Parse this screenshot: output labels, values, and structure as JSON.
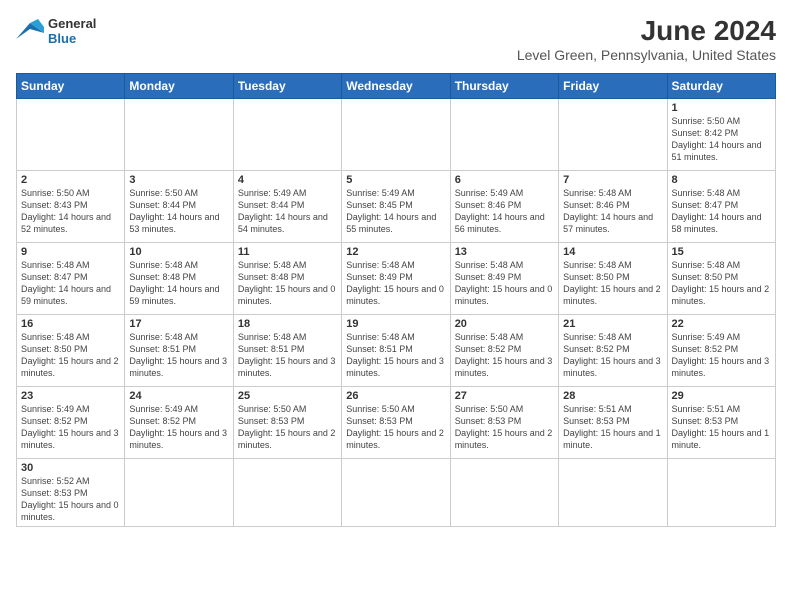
{
  "logo": {
    "text_general": "General",
    "text_blue": "Blue"
  },
  "header": {
    "title": "June 2024",
    "subtitle": "Level Green, Pennsylvania, United States"
  },
  "weekdays": [
    "Sunday",
    "Monday",
    "Tuesday",
    "Wednesday",
    "Thursday",
    "Friday",
    "Saturday"
  ],
  "weeks": [
    [
      {
        "day": "",
        "info": ""
      },
      {
        "day": "",
        "info": ""
      },
      {
        "day": "",
        "info": ""
      },
      {
        "day": "",
        "info": ""
      },
      {
        "day": "",
        "info": ""
      },
      {
        "day": "",
        "info": ""
      },
      {
        "day": "1",
        "info": "Sunrise: 5:50 AM\nSunset: 8:42 PM\nDaylight: 14 hours and 51 minutes."
      }
    ],
    [
      {
        "day": "2",
        "info": "Sunrise: 5:50 AM\nSunset: 8:43 PM\nDaylight: 14 hours and 52 minutes."
      },
      {
        "day": "3",
        "info": "Sunrise: 5:50 AM\nSunset: 8:44 PM\nDaylight: 14 hours and 53 minutes."
      },
      {
        "day": "4",
        "info": "Sunrise: 5:49 AM\nSunset: 8:44 PM\nDaylight: 14 hours and 54 minutes."
      },
      {
        "day": "5",
        "info": "Sunrise: 5:49 AM\nSunset: 8:45 PM\nDaylight: 14 hours and 55 minutes."
      },
      {
        "day": "6",
        "info": "Sunrise: 5:49 AM\nSunset: 8:46 PM\nDaylight: 14 hours and 56 minutes."
      },
      {
        "day": "7",
        "info": "Sunrise: 5:48 AM\nSunset: 8:46 PM\nDaylight: 14 hours and 57 minutes."
      },
      {
        "day": "8",
        "info": "Sunrise: 5:48 AM\nSunset: 8:47 PM\nDaylight: 14 hours and 58 minutes."
      }
    ],
    [
      {
        "day": "9",
        "info": "Sunrise: 5:48 AM\nSunset: 8:47 PM\nDaylight: 14 hours and 59 minutes."
      },
      {
        "day": "10",
        "info": "Sunrise: 5:48 AM\nSunset: 8:48 PM\nDaylight: 14 hours and 59 minutes."
      },
      {
        "day": "11",
        "info": "Sunrise: 5:48 AM\nSunset: 8:48 PM\nDaylight: 15 hours and 0 minutes."
      },
      {
        "day": "12",
        "info": "Sunrise: 5:48 AM\nSunset: 8:49 PM\nDaylight: 15 hours and 0 minutes."
      },
      {
        "day": "13",
        "info": "Sunrise: 5:48 AM\nSunset: 8:49 PM\nDaylight: 15 hours and 0 minutes."
      },
      {
        "day": "14",
        "info": "Sunrise: 5:48 AM\nSunset: 8:50 PM\nDaylight: 15 hours and 2 minutes."
      },
      {
        "day": "15",
        "info": "Sunrise: 5:48 AM\nSunset: 8:50 PM\nDaylight: 15 hours and 2 minutes."
      }
    ],
    [
      {
        "day": "16",
        "info": "Sunrise: 5:48 AM\nSunset: 8:50 PM\nDaylight: 15 hours and 2 minutes."
      },
      {
        "day": "17",
        "info": "Sunrise: 5:48 AM\nSunset: 8:51 PM\nDaylight: 15 hours and 3 minutes."
      },
      {
        "day": "18",
        "info": "Sunrise: 5:48 AM\nSunset: 8:51 PM\nDaylight: 15 hours and 3 minutes."
      },
      {
        "day": "19",
        "info": "Sunrise: 5:48 AM\nSunset: 8:51 PM\nDaylight: 15 hours and 3 minutes."
      },
      {
        "day": "20",
        "info": "Sunrise: 5:48 AM\nSunset: 8:52 PM\nDaylight: 15 hours and 3 minutes."
      },
      {
        "day": "21",
        "info": "Sunrise: 5:48 AM\nSunset: 8:52 PM\nDaylight: 15 hours and 3 minutes."
      },
      {
        "day": "22",
        "info": "Sunrise: 5:49 AM\nSunset: 8:52 PM\nDaylight: 15 hours and 3 minutes."
      }
    ],
    [
      {
        "day": "23",
        "info": "Sunrise: 5:49 AM\nSunset: 8:52 PM\nDaylight: 15 hours and 3 minutes."
      },
      {
        "day": "24",
        "info": "Sunrise: 5:49 AM\nSunset: 8:52 PM\nDaylight: 15 hours and 3 minutes."
      },
      {
        "day": "25",
        "info": "Sunrise: 5:50 AM\nSunset: 8:53 PM\nDaylight: 15 hours and 2 minutes."
      },
      {
        "day": "26",
        "info": "Sunrise: 5:50 AM\nSunset: 8:53 PM\nDaylight: 15 hours and 2 minutes."
      },
      {
        "day": "27",
        "info": "Sunrise: 5:50 AM\nSunset: 8:53 PM\nDaylight: 15 hours and 2 minutes."
      },
      {
        "day": "28",
        "info": "Sunrise: 5:51 AM\nSunset: 8:53 PM\nDaylight: 15 hours and 1 minute."
      },
      {
        "day": "29",
        "info": "Sunrise: 5:51 AM\nSunset: 8:53 PM\nDaylight: 15 hours and 1 minute."
      }
    ],
    [
      {
        "day": "30",
        "info": "Sunrise: 5:52 AM\nSunset: 8:53 PM\nDaylight: 15 hours and 0 minutes."
      },
      {
        "day": "",
        "info": ""
      },
      {
        "day": "",
        "info": ""
      },
      {
        "day": "",
        "info": ""
      },
      {
        "day": "",
        "info": ""
      },
      {
        "day": "",
        "info": ""
      },
      {
        "day": "",
        "info": ""
      }
    ]
  ]
}
